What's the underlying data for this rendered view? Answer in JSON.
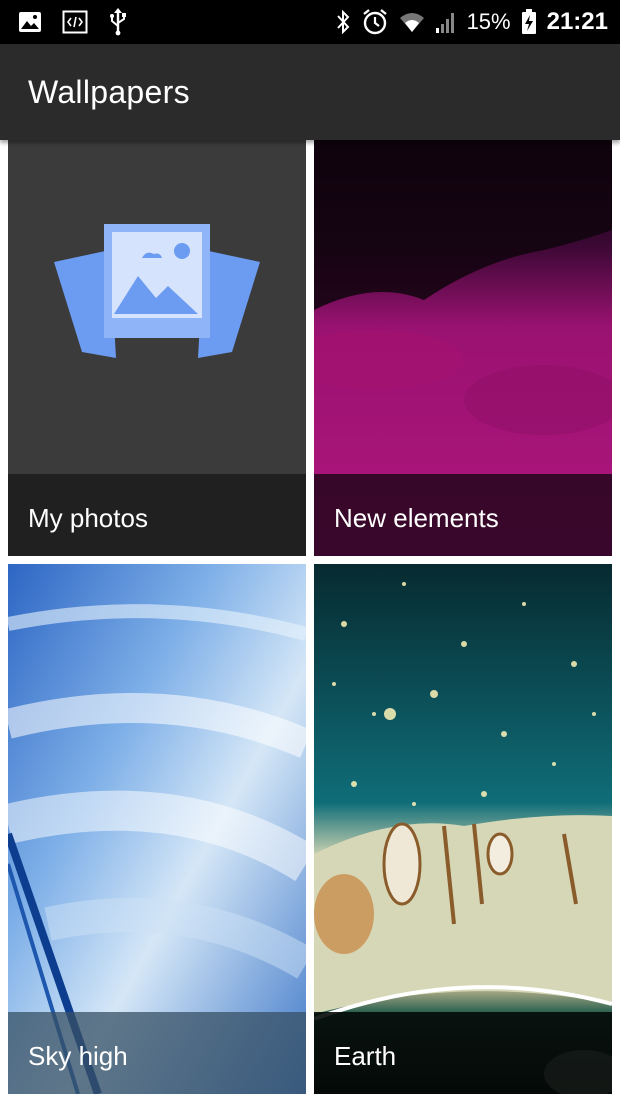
{
  "status_bar": {
    "battery": "15%",
    "time": "21:21",
    "left_icons": [
      "image-icon",
      "code-icon",
      "usb-icon"
    ],
    "right_icons": [
      "bluetooth-icon",
      "alarm-icon",
      "wifi-icon",
      "signal-icon",
      "battery-charging-icon"
    ]
  },
  "app_bar": {
    "title": "Wallpapers",
    "background": "#2b2b2b"
  },
  "tiles": [
    {
      "label": "My photos",
      "icon": "photos-stack-icon",
      "accent": "#6b9cf2"
    },
    {
      "label": "New elements",
      "accent": "#b0157e"
    },
    {
      "label": "Sky high",
      "accent": "#4f86cc"
    },
    {
      "label": "Earth",
      "accent": "#0a2f34"
    }
  ]
}
